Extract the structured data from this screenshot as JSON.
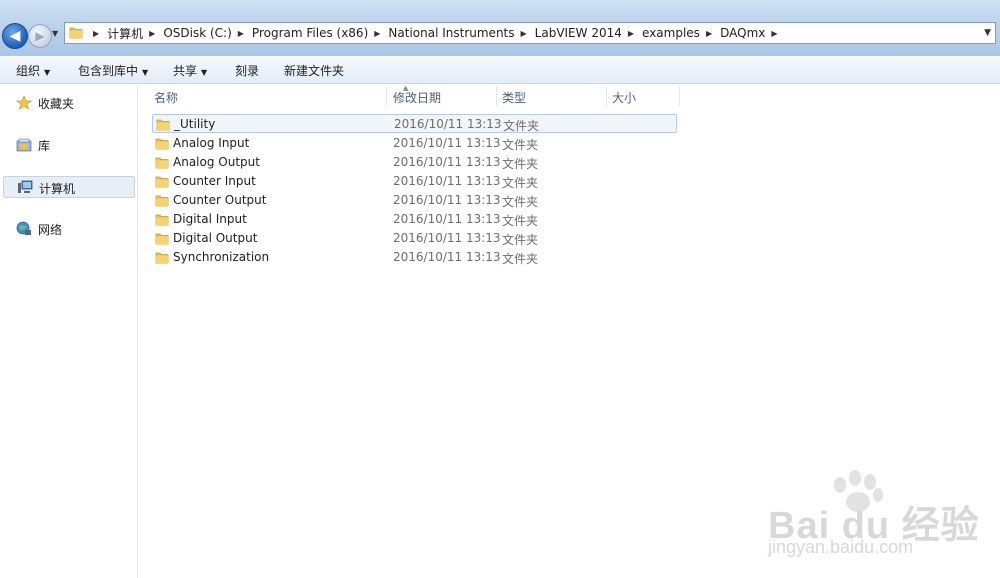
{
  "address": {
    "crumbs": [
      "计算机",
      "OSDisk (C:)",
      "Program Files (x86)",
      "National Instruments",
      "LabVIEW 2014",
      "examples",
      "DAQmx"
    ]
  },
  "toolbar": {
    "organize": "组织",
    "include_in_library": "包含到库中",
    "share": "共享",
    "burn": "刻录",
    "new_folder": "新建文件夹"
  },
  "nav": {
    "favorites": "收藏夹",
    "libraries": "库",
    "computer": "计算机",
    "network": "网络"
  },
  "columns": {
    "name": "名称",
    "date": "修改日期",
    "type": "类型",
    "size": "大小"
  },
  "files": [
    {
      "name": "_Utility",
      "date": "2016/10/11 13:13",
      "type": "文件夹"
    },
    {
      "name": "Analog Input",
      "date": "2016/10/11 13:13",
      "type": "文件夹"
    },
    {
      "name": "Analog Output",
      "date": "2016/10/11 13:13",
      "type": "文件夹"
    },
    {
      "name": "Counter Input",
      "date": "2016/10/11 13:13",
      "type": "文件夹"
    },
    {
      "name": "Counter Output",
      "date": "2016/10/11 13:13",
      "type": "文件夹"
    },
    {
      "name": "Digital Input",
      "date": "2016/10/11 13:13",
      "type": "文件夹"
    },
    {
      "name": "Digital Output",
      "date": "2016/10/11 13:13",
      "type": "文件夹"
    },
    {
      "name": "Synchronization",
      "date": "2016/10/11 13:13",
      "type": "文件夹"
    }
  ],
  "watermark": {
    "brand": "Bai du 经验",
    "url": "jingyan.baidu.com"
  },
  "colors": {
    "folder": "#e8c04f",
    "selection": "#b6cbe3",
    "accent": "#1d5fb5"
  }
}
